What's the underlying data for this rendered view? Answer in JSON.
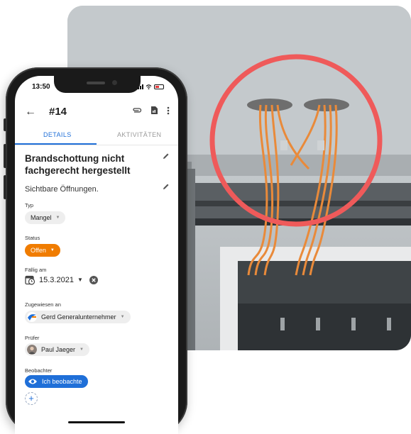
{
  "status_bar": {
    "time": "13:50"
  },
  "app_bar": {
    "back_icon": "arrow-left-icon",
    "issue_number": "#14"
  },
  "tabs": [
    {
      "label": "DETAILS",
      "active": true
    },
    {
      "label": "AKTIVITÄTEN",
      "active": false
    }
  ],
  "issue": {
    "title": "Brandschottung nicht fachgerecht hergestellt",
    "description": "Sichtbare Öffnungen."
  },
  "fields": {
    "type": {
      "label": "Typ",
      "value": "Mangel"
    },
    "status": {
      "label": "Status",
      "value": "Offen"
    },
    "due": {
      "label": "Fällig am",
      "value": "15.3.2021"
    },
    "assigned": {
      "label": "Zugewiesen an",
      "value": "Gerd Generalunternehmer"
    },
    "inspector": {
      "label": "Prüfer",
      "value": "Paul Jaeger"
    },
    "observers": {
      "label": "Beobachter",
      "value": "Ich beobachte"
    }
  },
  "colors": {
    "accent": "#1f6fd8",
    "status_orange": "#f07c00",
    "highlight_circle": "#ef5a5a",
    "cable_orange": "#e98a3a"
  }
}
